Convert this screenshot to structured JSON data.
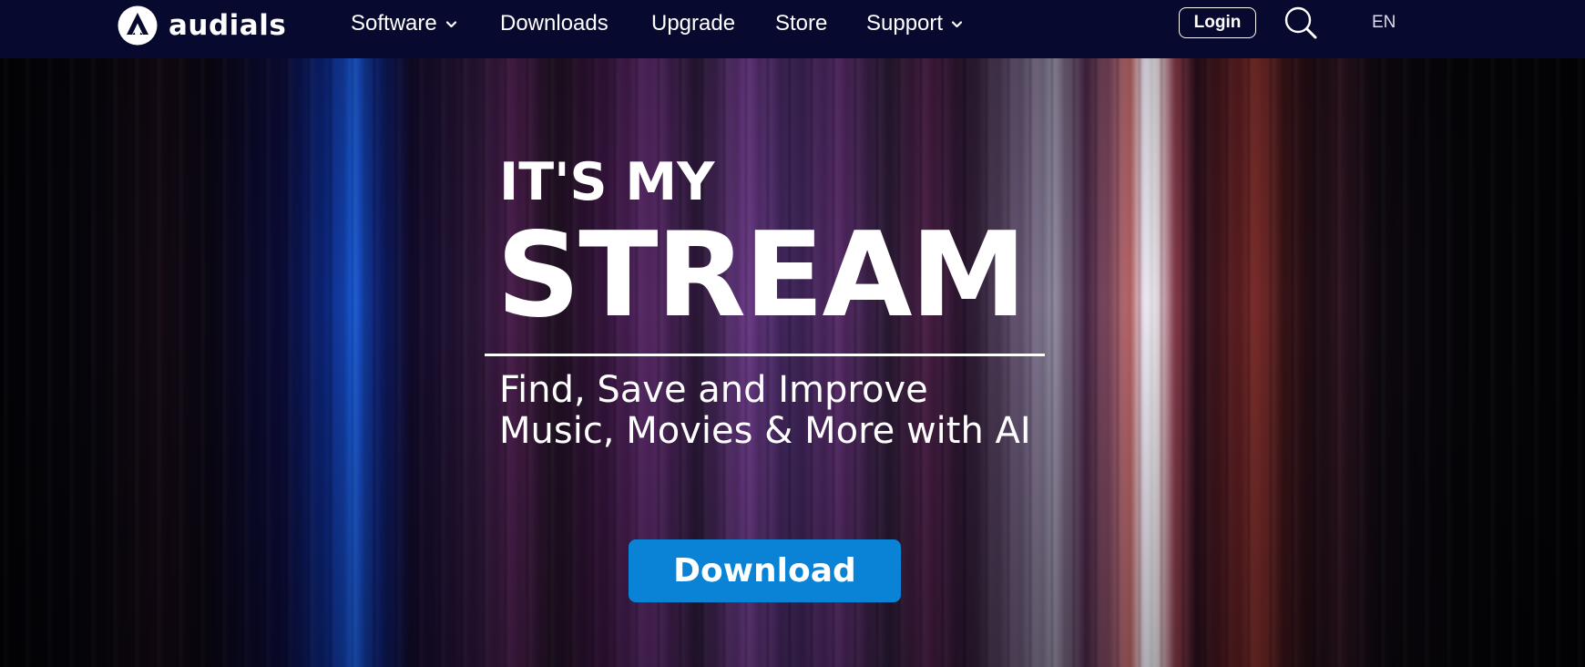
{
  "header": {
    "brand": "audials",
    "nav": [
      {
        "label": "Software",
        "dropdown": true
      },
      {
        "label": "Downloads",
        "dropdown": false
      },
      {
        "label": "Upgrade",
        "dropdown": false
      },
      {
        "label": "Store",
        "dropdown": false
      },
      {
        "label": "Support",
        "dropdown": true
      }
    ],
    "login_label": "Login",
    "search_icon": "search-icon",
    "language": "EN"
  },
  "hero": {
    "line1": "IT'S MY",
    "line2": "STREAM",
    "subtitle_line1": "Find, Save and Improve",
    "subtitle_line2": "Music, Movies & More with AI",
    "cta_label": "Download"
  },
  "colors": {
    "nav_background": "#070a2e",
    "cta_blue": "#0a82d6",
    "text": "#ffffff"
  }
}
